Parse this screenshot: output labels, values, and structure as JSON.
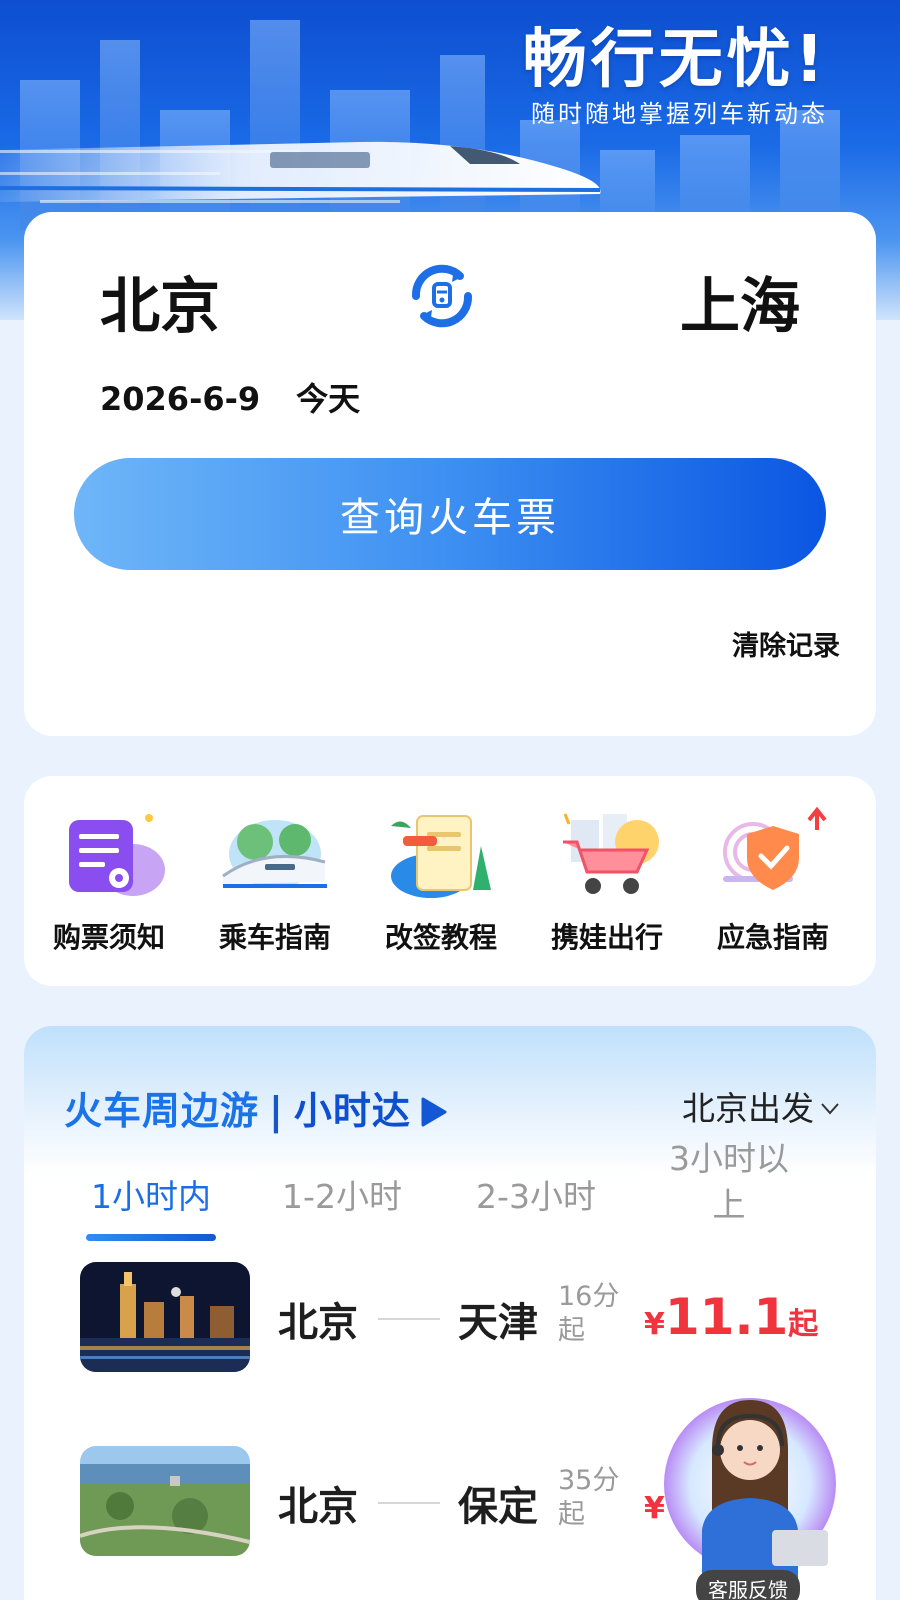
{
  "hero": {
    "title": "畅行无忧!",
    "subtitle": "随时随地掌握列车新动态"
  },
  "search": {
    "from_city": "北京",
    "to_city": "上海",
    "date": "2026-6-9",
    "day_label": "今天",
    "query_button": "查询火车票",
    "clear_history": "清除记录",
    "swap_icon": "swap-cities-icon"
  },
  "tools": [
    {
      "label": "购票须知",
      "icon": "ticket-notice-icon"
    },
    {
      "label": "乘车指南",
      "icon": "train-guide-icon"
    },
    {
      "label": "改签教程",
      "icon": "rebook-tutorial-icon"
    },
    {
      "label": "携娃出行",
      "icon": "stroller-icon"
    },
    {
      "label": "应急指南",
      "icon": "emergency-shield-icon"
    }
  ],
  "travel": {
    "title": "火车周边游",
    "separator": "|",
    "subtitle": "小时达",
    "depart_select": "北京出发",
    "tabs": [
      "1小时内",
      "1-2小时",
      "2-3小时",
      "3小时以上"
    ],
    "active_tab": 0,
    "routes": [
      {
        "from": "北京",
        "to": "天津",
        "duration": "16分起",
        "currency": "¥",
        "price": "11.1",
        "suffix": "起"
      },
      {
        "from": "北京",
        "to": "保定",
        "duration": "35分起",
        "currency": "¥",
        "price": "",
        "suffix": ""
      }
    ]
  },
  "service": {
    "label": "客服反馈"
  },
  "colors": {
    "accent": "#1a6fe6",
    "price": "#f0333d",
    "button_start": "#6fb6f8",
    "button_end": "#0b56e2",
    "page_bg": "#eaf3fd"
  }
}
